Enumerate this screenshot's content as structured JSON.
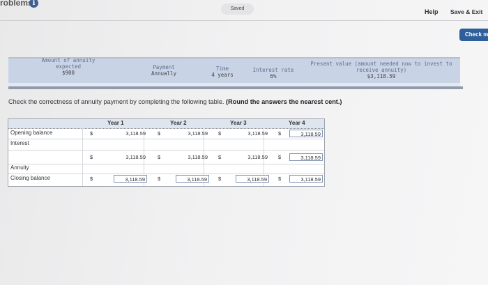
{
  "app": {
    "title": "roblems",
    "info_icon": "i"
  },
  "status": {
    "saved": "Saved"
  },
  "nav": {
    "help": "Help",
    "save_exit": "Save & Exit",
    "check": "Check m"
  },
  "annuity": {
    "amount_label": "Amount of annuity expected",
    "amount_value": "$900",
    "payment_label": "Payment",
    "payment_value": "Annually",
    "time_label": "Time",
    "time_value": "4 years",
    "rate_label": "Interest rate",
    "rate_value": "6%",
    "pv_label": "Present value (amount needed now to invest to receive annuity)",
    "pv_value": "$3,118.59"
  },
  "instruction": {
    "text": "Check the correctness of annuity payment by completing the following table.",
    "bold": "(Round the answers the nearest cent.)"
  },
  "table": {
    "headers": [
      "Year 1",
      "Year 2",
      "Year 3",
      "Year 4"
    ],
    "rows": {
      "opening_balance": "Opening balance",
      "interest": "Interest",
      "annuity": "Annuity",
      "closing_balance": "Closing balance"
    },
    "currency": "$",
    "opening_values": [
      "3,118.59",
      "3,118.59",
      "3,118.59",
      "3,118.59"
    ],
    "mid_values": [
      "3,118.59",
      "3,118.59",
      "3,118.59",
      "3,118.59"
    ],
    "closing_values": [
      "3,118.59",
      "3,118.59",
      "3,118.59",
      "3,118.59"
    ]
  }
}
